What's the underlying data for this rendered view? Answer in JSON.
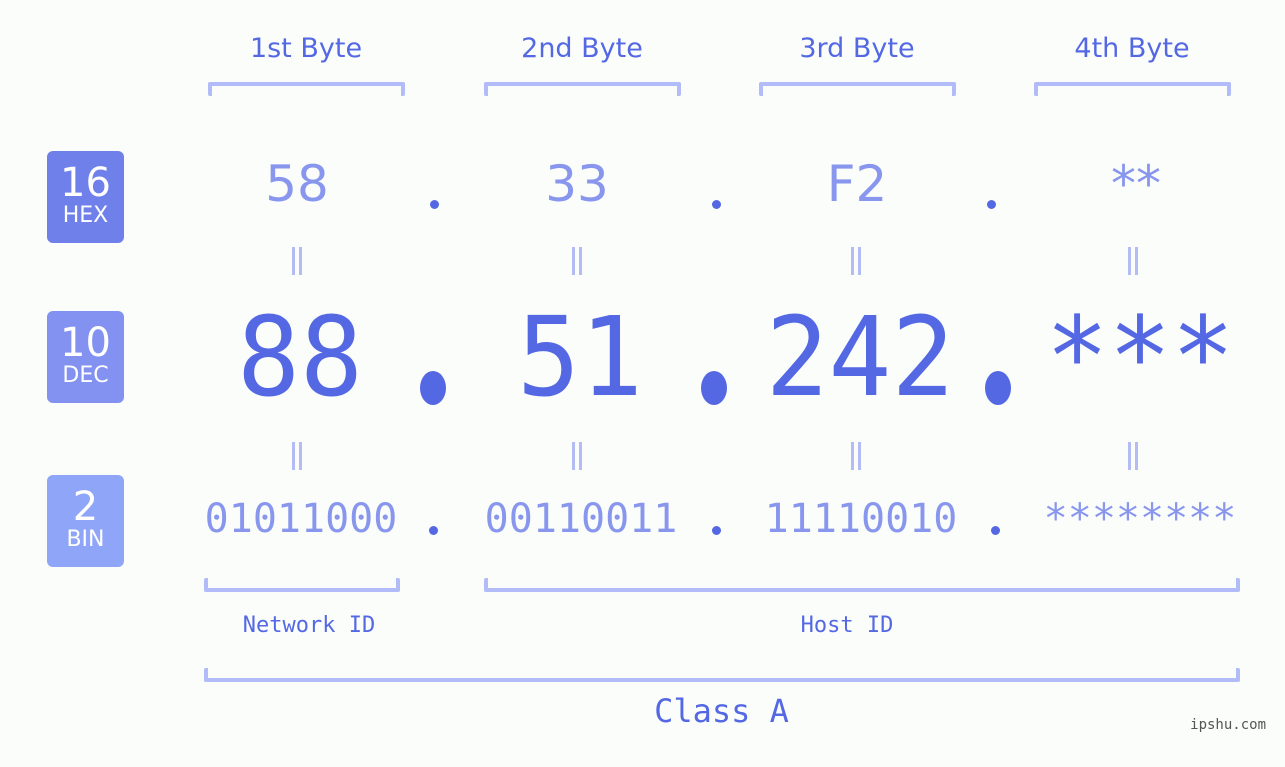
{
  "headers": [
    "1st Byte",
    "2nd Byte",
    "3rd Byte",
    "4th Byte"
  ],
  "badges": [
    {
      "base": "16",
      "label": "HEX",
      "color": "#6f80ea"
    },
    {
      "base": "10",
      "label": "DEC",
      "color": "#8392f0"
    },
    {
      "base": "2",
      "label": "BIN",
      "color": "#8fa6f8"
    }
  ],
  "hex": [
    "58",
    "33",
    "F2",
    "**"
  ],
  "dec": [
    "88",
    "51",
    "242",
    "***"
  ],
  "bin": [
    "01011000",
    "00110011",
    "11110010",
    "********"
  ],
  "separator": ".",
  "network_label": "Network ID",
  "host_label": "Host ID",
  "class_label": "Class A",
  "watermark": "ipshu.com",
  "colors": {
    "accent": "#5468e4",
    "light_value": "#8896ee",
    "bracket": "#b2bcf8",
    "background": "#fbfdfb"
  }
}
